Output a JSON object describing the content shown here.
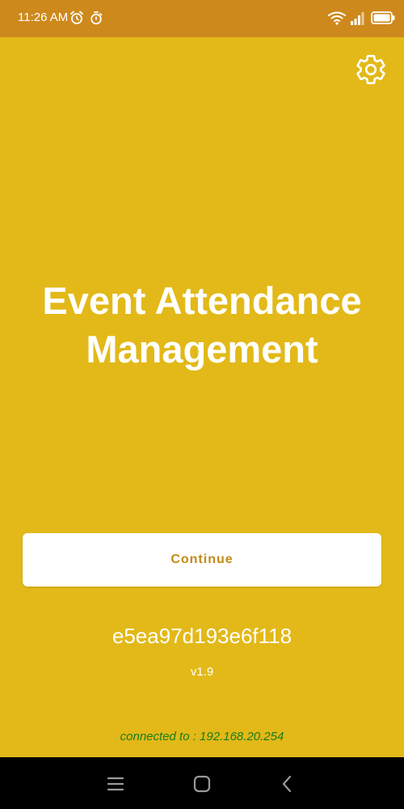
{
  "status_bar": {
    "time": "11:26 AM",
    "icons": [
      "alarm-icon",
      "stopwatch-icon",
      "wifi-icon",
      "signal-icon",
      "battery-icon"
    ]
  },
  "header": {
    "settings_icon": "gear-icon"
  },
  "main": {
    "title_line1": "Event Attendance",
    "title_line2": "Management",
    "continue_label": "Continue",
    "device_id": "e5ea97d193e6f118",
    "version": "v1.9",
    "connection_text": "connected to : 192.168.20.254"
  },
  "nav_bar": {
    "items": [
      "menu-icon",
      "home-icon",
      "back-icon"
    ]
  },
  "colors": {
    "background": "#E2B918",
    "status_bar": "#CE891C",
    "button_text": "#C48A14",
    "connection_text": "#1A7C1A"
  }
}
